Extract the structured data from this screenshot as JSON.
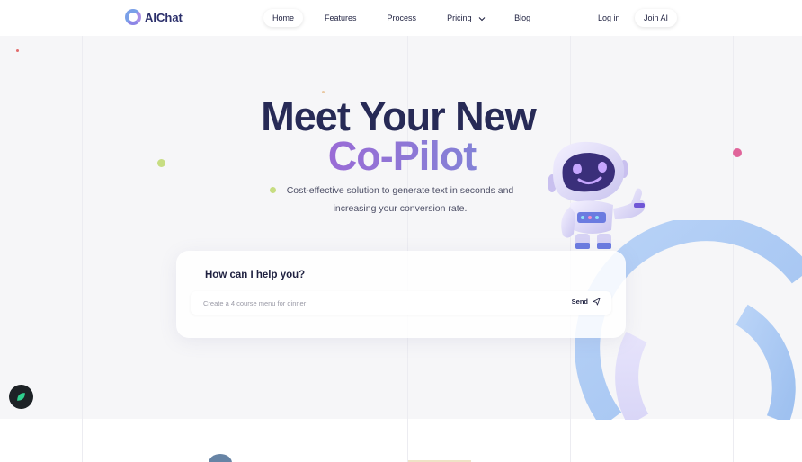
{
  "brand": {
    "name": "AIChat"
  },
  "nav": {
    "items": [
      {
        "label": "Home"
      },
      {
        "label": "Features"
      },
      {
        "label": "Process"
      },
      {
        "label": "Pricing"
      },
      {
        "label": "Blog"
      }
    ],
    "login_label": "Log in",
    "join_label": "Join AI"
  },
  "hero": {
    "title_line1": "Meet Your New",
    "title_line2": "Co-Pilot",
    "subtitle_line1": "Cost-effective solution to generate text in seconds and",
    "subtitle_line2": "increasing your conversion rate."
  },
  "chat": {
    "title": "How can I help you?",
    "placeholder": "Create a 4 course menu for dinner",
    "send_label": "Send"
  },
  "colors": {
    "heading": "#272a56",
    "gradient_start": "#8f4fd8",
    "gradient_end": "#52b4d8",
    "accent_pink": "#e0649a",
    "accent_green": "#c7dd82",
    "arc_blue": "#a9c7f3"
  }
}
